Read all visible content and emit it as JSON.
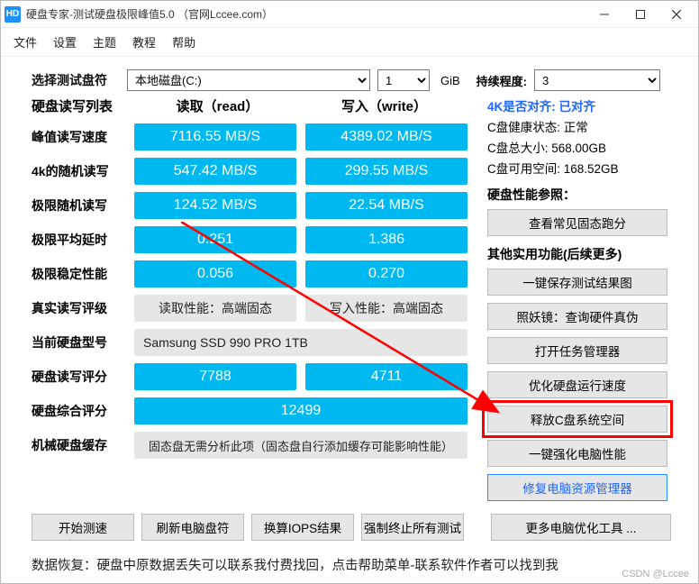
{
  "window": {
    "icon_text": "HD",
    "title": "硬盘专家-测试硬盘极限峰值5.0 （官网Lccee.com）"
  },
  "menu": [
    "文件",
    "设置",
    "主题",
    "教程",
    "帮助"
  ],
  "selectors": {
    "disk_label": "选择测试盘符",
    "disk_value": "本地磁盘(C:)",
    "qty_value": "1",
    "unit": "GiB",
    "duration_label": "持续程度:",
    "duration_value": "3"
  },
  "headers": {
    "list_label": "硬盘读写列表",
    "read": "读取（read）",
    "write": "写入（write）"
  },
  "metrics": [
    {
      "label": "峰值读写速度",
      "read": "7116.55 MB/S",
      "write": "4389.02 MB/S"
    },
    {
      "label": "4k的随机读写",
      "read": "547.42 MB/S",
      "write": "299.55 MB/S"
    },
    {
      "label": "极限随机读写",
      "read": "124.52 MB/S",
      "write": "22.54 MB/S"
    },
    {
      "label": "极限平均延时",
      "read": "0.251",
      "write": "1.386"
    },
    {
      "label": "极限稳定性能",
      "read": "0.056",
      "write": "0.270"
    },
    {
      "label": "真实读写评级",
      "read": "读取性能：高端固态",
      "write": "写入性能：高端固态",
      "gray": true
    }
  ],
  "model": {
    "label": "当前硬盘型号",
    "value": "Samsung SSD 990 PRO 1TB"
  },
  "score": {
    "label": "硬盘读写评分",
    "read": "7788",
    "write": "4711"
  },
  "total": {
    "label": "硬盘综合评分",
    "value": "12499"
  },
  "cache": {
    "label": "机械硬盘缓存",
    "value": "固态盘无需分析此项（固态盘自行添加缓存可能影响性能）"
  },
  "info": {
    "align_label": "4K是否对齐:",
    "align_value": "已对齐",
    "health": "C盘健康状态: 正常",
    "total_size": "C盘总大小: 568.00GB",
    "free": "C盘可用空间: 168.52GB"
  },
  "perf_ref": {
    "title": "硬盘性能参照：",
    "btn": "查看常见固态跑分"
  },
  "tools": {
    "title": "其他实用功能(后续更多)",
    "items": [
      "一键保存测试结果图",
      "照妖镜：查询硬件真伪",
      "打开任务管理器",
      "优化硬盘运行速度",
      "释放C盘系统空间",
      "一键强化电脑性能",
      "修复电脑资源管理器"
    ],
    "more": "更多电脑优化工具 ..."
  },
  "bottom_buttons": [
    "开始测速",
    "刷新电脑盘符",
    "换算IOPS结果",
    "强制终止所有测试"
  ],
  "footer": "数据恢复：硬盘中原数据丢失可以联系我付费找回，点击帮助菜单-联系软件作者可以找到我",
  "watermark": "CSDN @Lccee"
}
